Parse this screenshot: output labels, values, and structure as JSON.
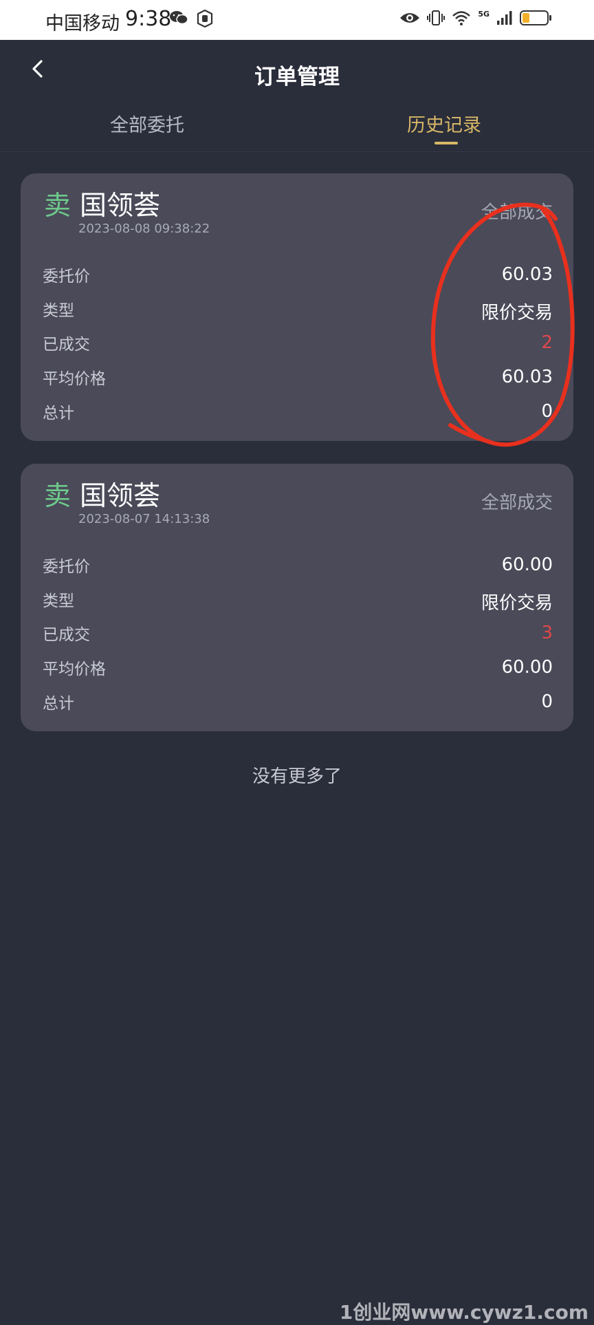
{
  "status_bar": {
    "carrier": "中国移动",
    "time": "9:38",
    "network": "5G"
  },
  "header": {
    "title": "订单管理"
  },
  "tabs": [
    {
      "label": "全部委托",
      "active": false
    },
    {
      "label": "历史记录",
      "active": true
    }
  ],
  "orders": [
    {
      "side": "卖",
      "name": "国领荟",
      "time": "2023-08-08 09:38:22",
      "status": "全部成交",
      "rows": [
        {
          "label": "委托价",
          "value": "60.03"
        },
        {
          "label": "类型",
          "value": "限价交易"
        },
        {
          "label": "已成交",
          "value": "2"
        },
        {
          "label": "平均价格",
          "value": "60.03"
        },
        {
          "label": "总计",
          "value": "0"
        }
      ]
    },
    {
      "side": "卖",
      "name": "国领荟",
      "time": "2023-08-07 14:13:38",
      "status": "全部成交",
      "rows": [
        {
          "label": "委托价",
          "value": "60.00"
        },
        {
          "label": "类型",
          "value": "限价交易"
        },
        {
          "label": "已成交",
          "value": "3"
        },
        {
          "label": "平均价格",
          "value": "60.00"
        },
        {
          "label": "总计",
          "value": "0"
        }
      ]
    }
  ],
  "footer": {
    "no_more": "没有更多了"
  },
  "watermark": "1创业网www.cywz1.com",
  "colors": {
    "background": "#2a2d3a",
    "card": "#4a4a59",
    "accent_gold": "#d8b867",
    "sell_green": "#6ec98b",
    "filled_red": "#e0474a",
    "annotation_red": "#e8301e"
  },
  "icons": {
    "back": "chevron-left-icon",
    "wechat": "wechat-icon",
    "eye": "eye-icon",
    "vibrate": "vibrate-icon",
    "wifi": "wifi-icon",
    "signal": "signal-icon",
    "battery": "battery-icon"
  }
}
